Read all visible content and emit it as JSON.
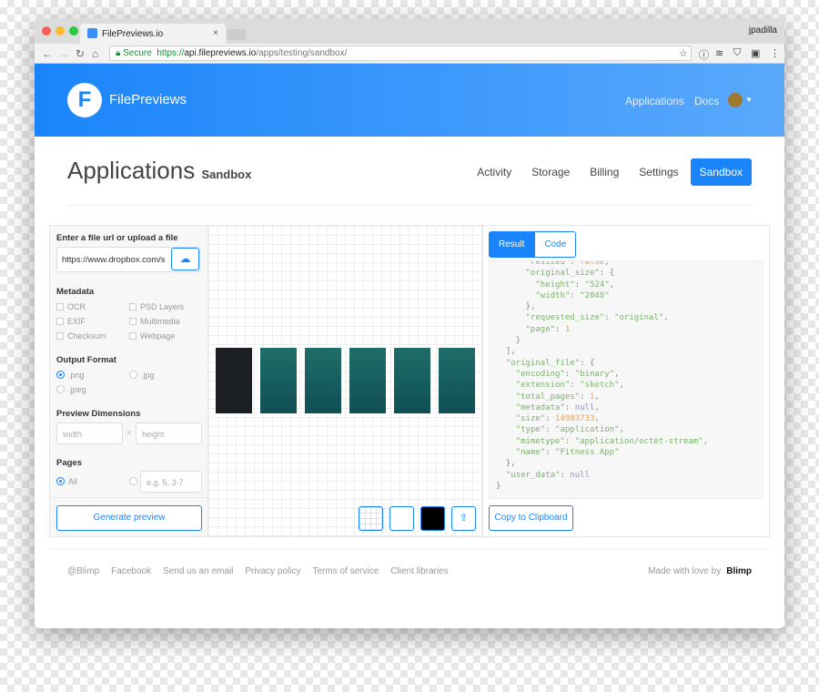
{
  "browser": {
    "tab_title": "FilePreviews.io",
    "user": "jpadilla",
    "secure_label": "Secure",
    "url_scheme": "https://",
    "url_host": "api.filepreviews.io",
    "url_path": "/apps/testing/sandbox/"
  },
  "header": {
    "brand": "FilePreviews",
    "logo_letter": "F",
    "nav": [
      "Applications",
      "Docs"
    ]
  },
  "page": {
    "title": "Applications",
    "subtitle": "Sandbox",
    "tabs": [
      "Activity",
      "Storage",
      "Billing",
      "Settings",
      "Sandbox"
    ],
    "active_tab": "Sandbox"
  },
  "form": {
    "url_label": "Enter a file url or upload a file",
    "url_value": "https://www.dropbox.com/s",
    "metadata_label": "Metadata",
    "metadata": [
      "OCR",
      "PSD Layers",
      "EXIF",
      "Multimedia",
      "Checksum",
      "Webpage"
    ],
    "format_label": "Output Format",
    "formats": [
      ".png",
      ".jpg",
      ".jpeg"
    ],
    "format_selected": ".png",
    "dims_label": "Preview Dimensions",
    "width_placeholder": "width",
    "height_placeholder": "height",
    "times": "×",
    "pages_label": "Pages",
    "pages_all": "All",
    "pages_placeholder": "e.g. 5, 3-7",
    "generate": "Generate preview"
  },
  "preview": {
    "thumbnail_count": 6,
    "backgrounds": [
      "grid",
      "white",
      "black"
    ]
  },
  "result": {
    "tabs": [
      "Result",
      "Code"
    ],
    "active_tab": "Result",
    "copy": "Copy to Clipboard",
    "code_lines": [
      "      \"resized\": false,",
      "      \"original_size\": {",
      "        \"height\": \"524\",",
      "        \"width\": \"2048\"",
      "      },",
      "      \"requested_size\": \"original\",",
      "      \"page\": 1",
      "    }",
      "  ],",
      "  \"original_file\": {",
      "    \"encoding\": \"binary\",",
      "    \"extension\": \"sketch\",",
      "    \"total_pages\": 1,",
      "    \"metadata\": null,",
      "    \"size\": 14983733,",
      "    \"type\": \"application\",",
      "    \"mimetype\": \"application/octet-stream\",",
      "    \"name\": \"Fitness App\"",
      "  },",
      "  \"user_data\": null",
      "}"
    ]
  },
  "footer": {
    "links": [
      "@Blimp",
      "Facebook",
      "Send us an email",
      "Privacy policy",
      "Terms of service",
      "Client libraries"
    ],
    "made_with": "Made with love by",
    "made_by": "Blimp"
  },
  "colors": {
    "accent": "#1a85fb"
  }
}
